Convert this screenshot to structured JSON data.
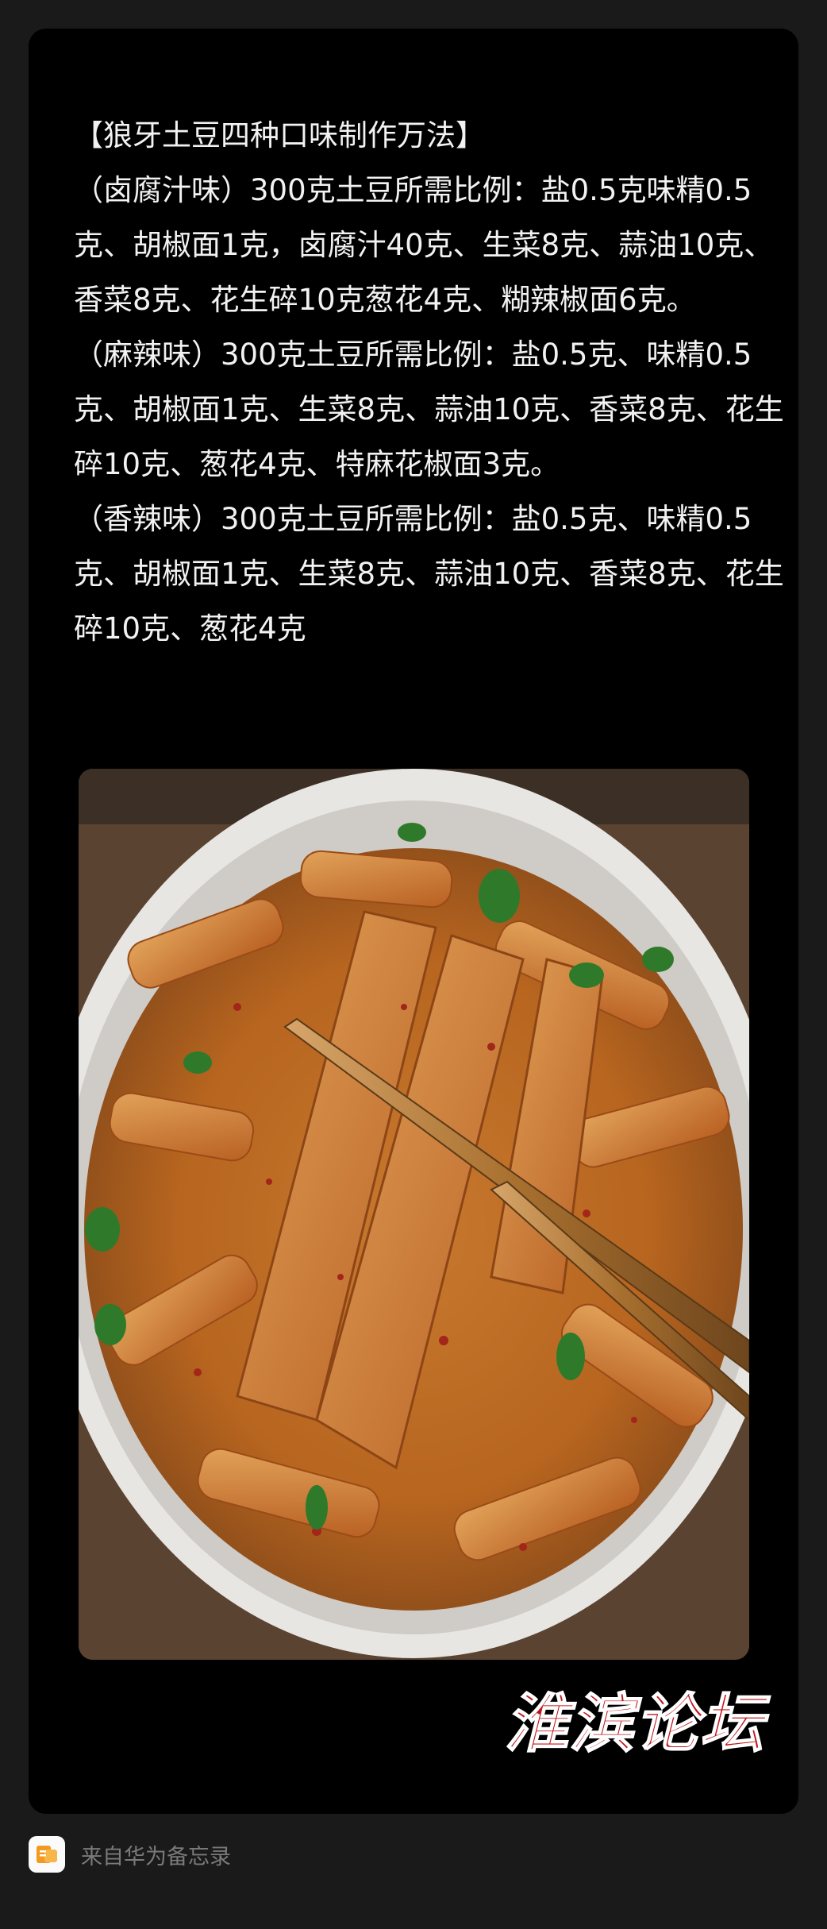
{
  "note": {
    "title": "【狼牙土豆四种口味制作万法】",
    "paragraphs": [
      "（卤腐汁味）300克土豆所需比例：盐0.5克味精0.5克、胡椒面1克，卤腐汁40克、生菜8克、蒜油10克、香菜8克、花生碎10克葱花4克、糊辣椒面6克。",
      "（麻辣味）300克土豆所需比例：盐0.5克、味精0.5克、胡椒面1克、生菜8克、蒜油10克、香菜8克、花生碎10克、葱花4克、特麻花椒面3克。",
      "（香辣味）300克土豆所需比例：盐0.5克、味精0.5克、胡椒面1克、生菜8克、蒜油10克、香菜8克、花生碎10克、葱花4克"
    ]
  },
  "watermark": {
    "text": "淮滨论坛",
    "color": "#c0151b"
  },
  "footer": {
    "source_label": "来自华为备忘录",
    "icon": "memo-app-icon",
    "icon_color": "#f39a1e"
  },
  "colors": {
    "background": "#1a1a1a",
    "card": "#000000",
    "text": "#f2f2f2",
    "muted": "#7a7a7a"
  }
}
